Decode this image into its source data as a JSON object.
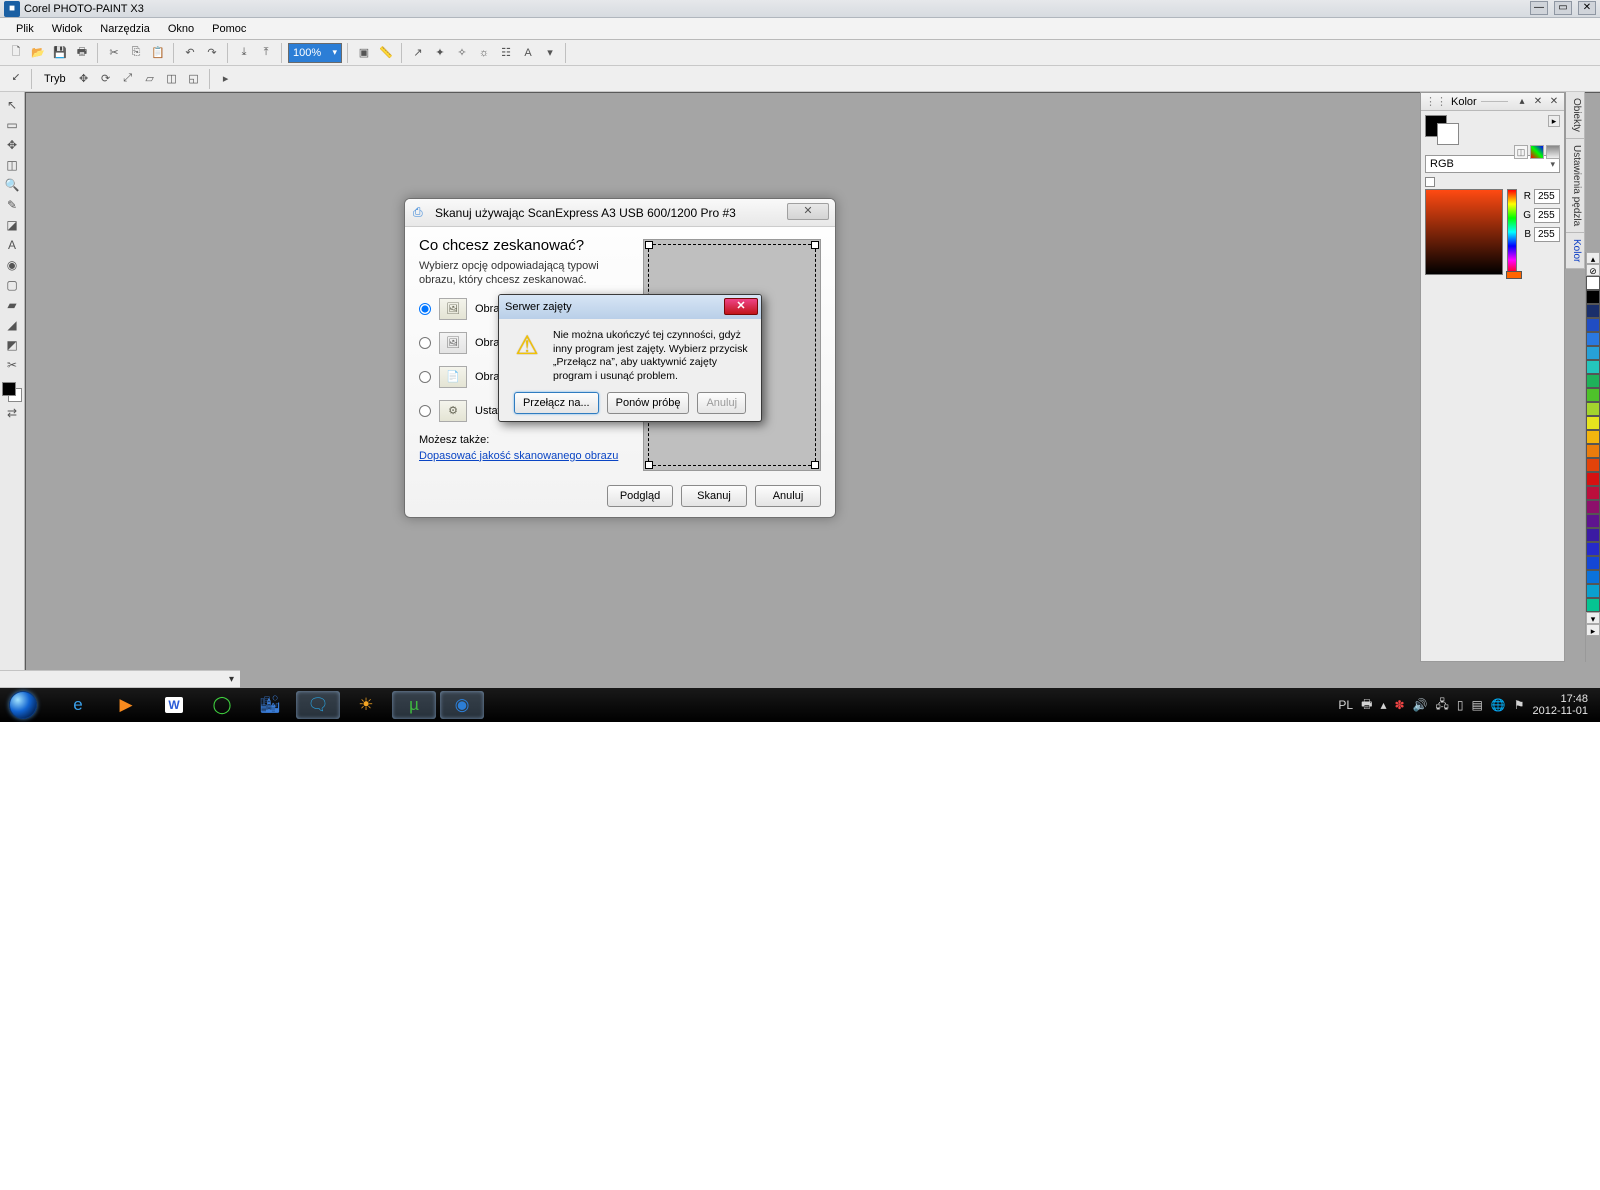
{
  "app": {
    "title": "Corel PHOTO-PAINT X3"
  },
  "menu": {
    "file": "Plik",
    "view": "Widok",
    "tools": "Narzędzia",
    "window": "Okno",
    "help": "Pomoc"
  },
  "toolbar": {
    "zoom": "100%",
    "mode_label": "Tryb"
  },
  "color_docker": {
    "title": "Kolor",
    "model": "RGB",
    "r": "255",
    "g": "255",
    "b": "255"
  },
  "side_tabs": {
    "objects": "Obiekty",
    "brushsettings": "Ustawienia pędzla",
    "color": "Kolor"
  },
  "scan": {
    "title": "Skanuj używając ScanExpress A3 USB 600/1200 Pro #3",
    "heading": "Co chcesz zeskanować?",
    "subtitle": "Wybierz opcję odpowiadającą typowi obrazu, który chcesz zeskanować.",
    "opt_color": "Obraz kolorowy",
    "opt_gray": "Obraz w skali szarości",
    "opt_bw": "Obraz czarno-biały",
    "opt_custom": "Ustawienia niestandardowe",
    "also": "Możesz także:",
    "link": "Dopasować jakość skanowanego obrazu",
    "preview": "Podgląd",
    "scan_btn": "Skanuj",
    "cancel": "Anuluj"
  },
  "busy": {
    "title": "Serwer zajęty",
    "msg": "Nie można ukończyć tej czynności, gdyż inny program jest zajęty. Wybierz przycisk „Przełącz na”, aby uaktywnić zajęty program i usunąć problem.",
    "switch": "Przełącz na...",
    "retry": "Ponów próbę",
    "cancel": "Anuluj"
  },
  "taskbar": {
    "lang": "PL",
    "time": "17:48",
    "date": "2012-11-01"
  },
  "palette_colors": [
    "#ffffff",
    "#000000",
    "#1a2f6b",
    "#204dc3",
    "#2a78e0",
    "#27a1d8",
    "#24c5bc",
    "#1fb25a",
    "#4ec22a",
    "#a3d42e",
    "#e6e41e",
    "#f2b50f",
    "#ea7c0c",
    "#e2430a",
    "#d61111",
    "#bb0f3c",
    "#8d106b",
    "#5e148f",
    "#3b1ba3",
    "#262acb",
    "#1447d6",
    "#0b72db",
    "#0aa0ce",
    "#06c492"
  ]
}
